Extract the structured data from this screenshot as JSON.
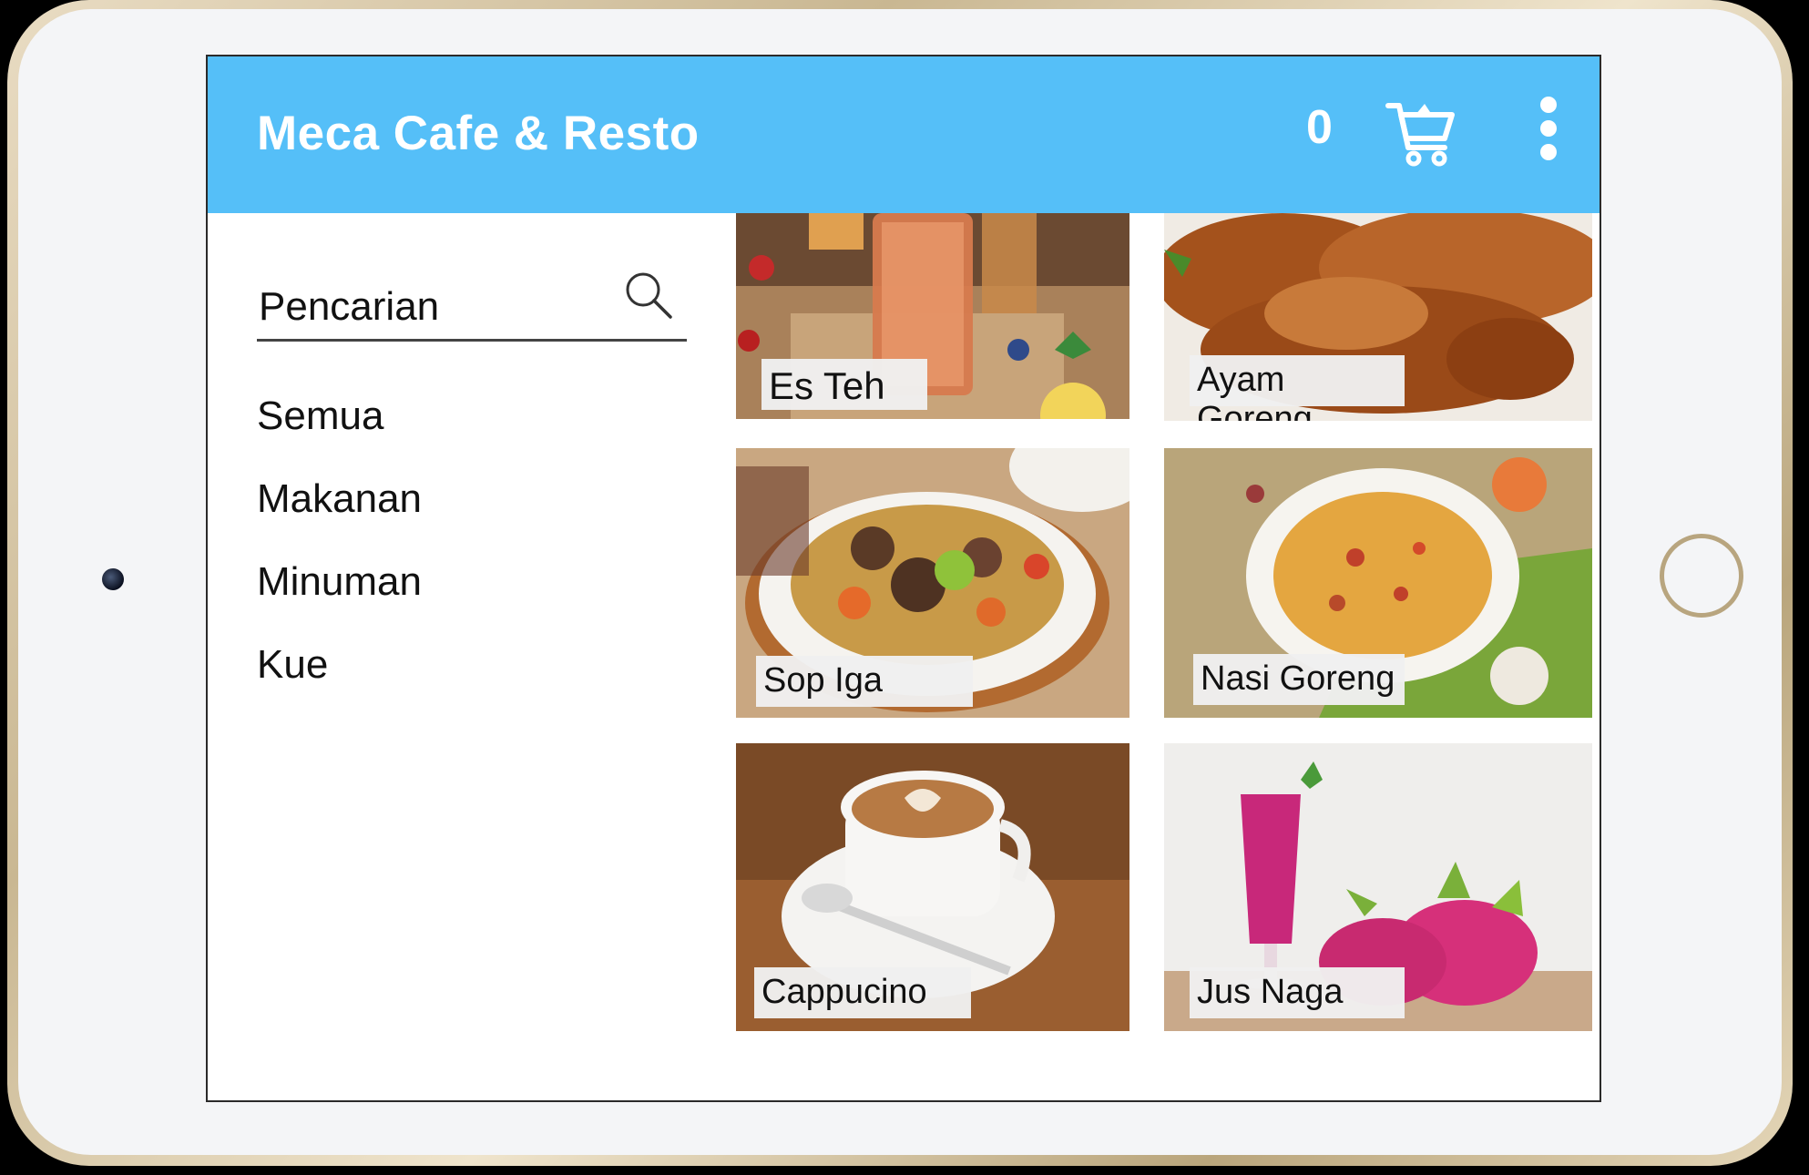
{
  "app": {
    "title": "Meca Cafe & Resto",
    "cart_count": "0",
    "accent_color": "#55bff8"
  },
  "search": {
    "placeholder": "Pencarian"
  },
  "categories": [
    {
      "label": "Semua"
    },
    {
      "label": "Makanan"
    },
    {
      "label": "Minuman"
    },
    {
      "label": "Kue"
    }
  ],
  "menu_items": [
    {
      "label": "Es Teh",
      "image": "iced-tea-photo"
    },
    {
      "label": "Ayam Goreng",
      "image": "fried-chicken-photo"
    },
    {
      "label": "Sop Iga",
      "image": "rib-soup-photo"
    },
    {
      "label": "Nasi Goreng",
      "image": "fried-rice-photo"
    },
    {
      "label": "Cappucino",
      "image": "cappuccino-photo"
    },
    {
      "label": "Jus Naga",
      "image": "dragon-fruit-juice-photo"
    }
  ],
  "icons": {
    "cart": "shopping-cart-icon",
    "more": "more-vertical-icon",
    "search": "search-icon"
  }
}
